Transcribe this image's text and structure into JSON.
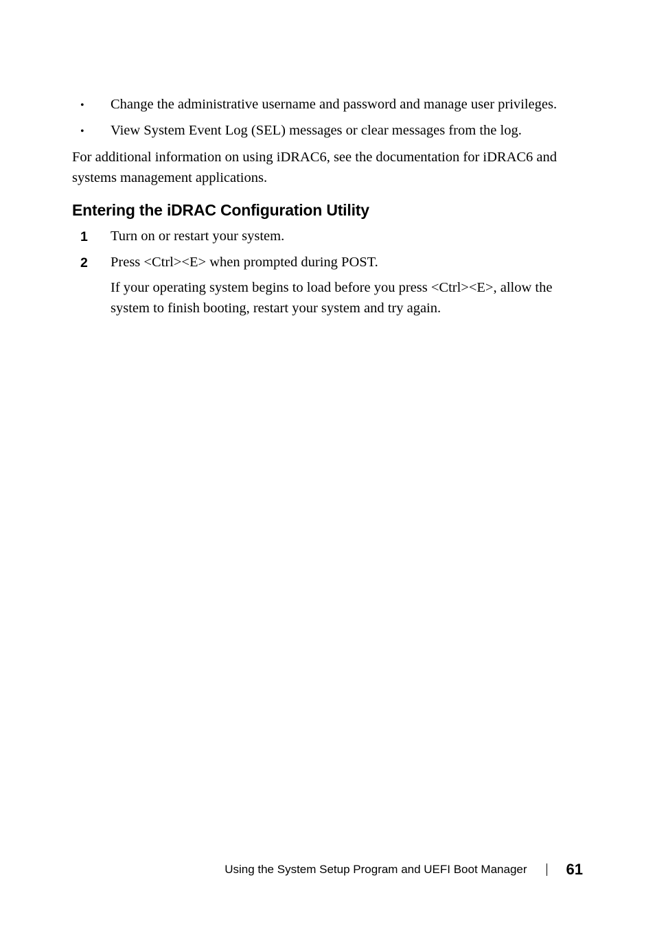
{
  "bullets": [
    "Change the administrative username and password and manage user privileges.",
    "View System Event Log (SEL) messages or clear messages from the log."
  ],
  "paragraph_after_bullets": "For additional information on using iDRAC6, see the documentation for iDRAC6 and systems management applications.",
  "section_heading": "Entering the iDRAC Configuration Utility",
  "steps": [
    {
      "num": "1",
      "text": "Turn on or restart your system."
    },
    {
      "num": "2",
      "text": "Press <Ctrl><E> when prompted during POST.",
      "sub": "If your operating system begins to load before you press <Ctrl><E>, allow the system to finish booting, restart your system and try again."
    }
  ],
  "footer": {
    "title": "Using the System Setup Program and UEFI Boot Manager",
    "page": "61"
  }
}
